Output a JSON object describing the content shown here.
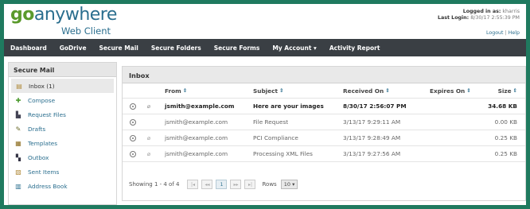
{
  "header": {
    "logo_go": "go",
    "logo_anywhere": "anywhere",
    "logo_sub": "Web Client",
    "logged_in_label": "Logged in as:",
    "logged_in_user": "kharris",
    "last_login_label": "Last Login:",
    "last_login_value": "8/30/17 2:55:39 PM",
    "logout_label": "Logout",
    "help_label": "Help"
  },
  "nav": {
    "items": [
      "Dashboard",
      "GoDrive",
      "Secure Mail",
      "Secure Folders",
      "Secure Forms",
      "My Account",
      "Activity Report"
    ],
    "my_account_caret": "▾"
  },
  "sidebar": {
    "title": "Secure Mail",
    "items": [
      {
        "label": "Inbox (1)",
        "icon": "inbox-icon",
        "glyph": "▤"
      },
      {
        "label": "Compose",
        "icon": "compose-icon",
        "glyph": "✚"
      },
      {
        "label": "Request Files",
        "icon": "request-files-icon",
        "glyph": "▙"
      },
      {
        "label": "Drafts",
        "icon": "drafts-icon",
        "glyph": "✎"
      },
      {
        "label": "Templates",
        "icon": "templates-icon",
        "glyph": "▦"
      },
      {
        "label": "Outbox",
        "icon": "outbox-icon",
        "glyph": "▚"
      },
      {
        "label": "Sent Items",
        "icon": "sent-items-icon",
        "glyph": "▧"
      },
      {
        "label": "Address Book",
        "icon": "address-book-icon",
        "glyph": "▥"
      }
    ]
  },
  "inbox": {
    "title": "Inbox",
    "columns": {
      "from": "From",
      "subject": "Subject",
      "received": "Received On",
      "expires": "Expires On",
      "size": "Size"
    },
    "sort_glyph": "⇕",
    "rows": [
      {
        "from": "jsmith@example.com",
        "subject": "Here are your images",
        "received": "8/30/17 2:56:07 PM",
        "expires": "",
        "size": "34.68 KB",
        "attachment": true
      },
      {
        "from": "jsmith@example.com",
        "subject": "File Request",
        "received": "3/13/17 9:29:11 AM",
        "expires": "",
        "size": "0.00 KB",
        "attachment": false
      },
      {
        "from": "jsmith@example.com",
        "subject": "PCI Compliance",
        "received": "3/13/17 9:28:49 AM",
        "expires": "",
        "size": "0.25 KB",
        "attachment": true
      },
      {
        "from": "jsmith@example.com",
        "subject": "Processing XML Files",
        "received": "3/13/17 9:27:56 AM",
        "expires": "",
        "size": "0.25 KB",
        "attachment": true
      }
    ],
    "pager": {
      "showing": "Showing 1 - 4 of 4",
      "first": "|◂",
      "prev": "◂◂",
      "current_page": "1",
      "next": "▸▸",
      "last": "▸|",
      "rows_label": "Rows",
      "rows_value": "10",
      "rows_caret": "▾"
    }
  },
  "colors": {
    "accent": "#2a6e8e",
    "brand_green": "#5a9a2c",
    "navbar": "#3a3f44",
    "border_bg": "#1f7a5f"
  }
}
